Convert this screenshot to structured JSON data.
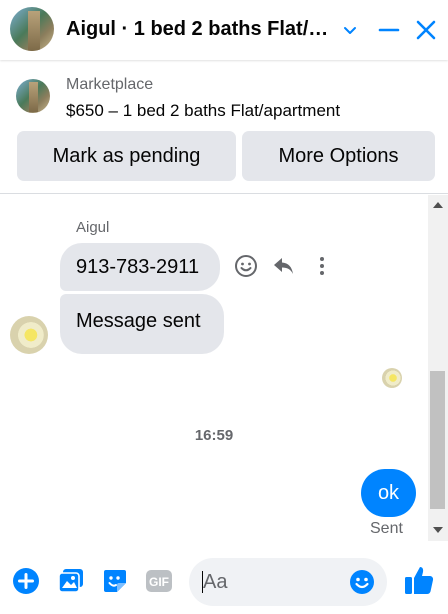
{
  "header": {
    "title": "Aigul · 1 bed 2 baths Flat/apartment",
    "icons": [
      "chevron-down-icon",
      "minimize-icon",
      "close-icon"
    ],
    "accent": "#0084ff"
  },
  "marketplace": {
    "label": "Marketplace",
    "listing": "$650 – 1 bed 2 baths Flat/apartment",
    "buttons": {
      "pending": "Mark as pending",
      "more": "More Options"
    }
  },
  "conversation": {
    "sender_name": "Aigul",
    "messages_in": [
      {
        "text": "913-783-2911"
      },
      {
        "text": "Message sent"
      }
    ],
    "timestamp": "16:59",
    "message_out": {
      "text": "ok",
      "status": "Sent"
    },
    "message_actions": [
      "react-icon",
      "reply-icon",
      "more-icon"
    ]
  },
  "composer": {
    "placeholder": "Aa",
    "icons": [
      "plus-icon",
      "image-icon",
      "sticker-icon",
      "gif-icon",
      "emoji-icon",
      "thumbs-up-icon"
    ],
    "gif_label": "GIF"
  }
}
